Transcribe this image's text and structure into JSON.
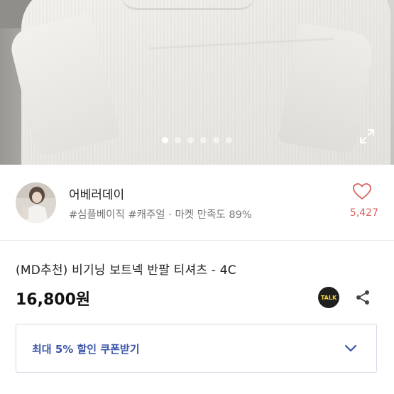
{
  "gallery": {
    "slide_count": 6,
    "active_index": 0,
    "expand_icon": "expand-icon"
  },
  "seller": {
    "name": "어베러데이",
    "tags": "#심플베이직 #캐주얼 · 마켓 만족도 89%",
    "like_count": "5,427",
    "like_icon": "heart-icon"
  },
  "product": {
    "title": "(MD추천) 비기닝 보트넥 반팔 티셔츠 - 4C",
    "price": "16,800원",
    "talk_label": "TALK",
    "share_icon": "share-icon"
  },
  "coupon": {
    "label": "최대 5% 할인 쿠폰받기",
    "chevron_icon": "chevron-down-icon"
  },
  "colors": {
    "accent_blue": "#3a55a8",
    "like_red": "#d95f5f",
    "talk_yellow": "#f3d33b"
  }
}
